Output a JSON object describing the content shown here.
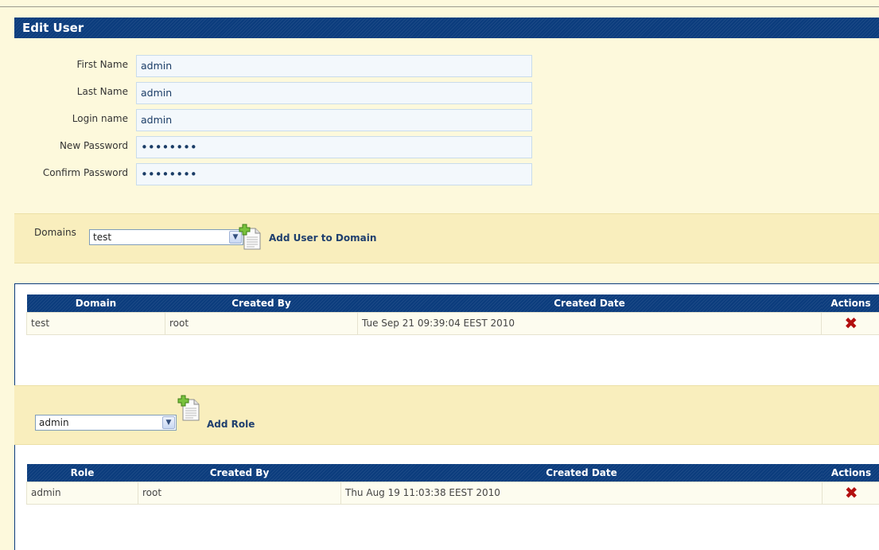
{
  "header": {
    "title": "Edit User"
  },
  "form": {
    "fields": [
      {
        "label": "First Name",
        "value": "admin"
      },
      {
        "label": "Last Name",
        "value": "admin"
      },
      {
        "label": "Login name",
        "value": "admin"
      },
      {
        "label": "New Password",
        "value": "••••••••"
      },
      {
        "label": "Confirm Password",
        "value": "••••••••"
      }
    ]
  },
  "domains_bar": {
    "label": "Domains",
    "selected": "test",
    "add_label": "Add User to Domain",
    "add_icon": "add-document-icon"
  },
  "domains_table": {
    "columns": [
      "Domain",
      "Created By",
      "Created Date",
      "Actions"
    ],
    "rows": [
      {
        "domain": "test",
        "created_by": "root",
        "created_date": "Tue Sep 21 09:39:04 EEST 2010",
        "action_icon": "✖"
      }
    ]
  },
  "roles_bar": {
    "selected": "admin",
    "add_label": "Add Role",
    "add_icon": "add-document-icon"
  },
  "roles_table": {
    "columns": [
      "Role",
      "Created By",
      "Created Date",
      "Actions"
    ],
    "rows": [
      {
        "role": "admin",
        "created_by": "root",
        "created_date": "Thu Aug 19 11:03:38 EEST 2010",
        "action_icon": "✖"
      }
    ]
  },
  "colors": {
    "header_blue": "#0b3c7d",
    "page_bg": "#fdf9dc",
    "band_bg": "#f9eebd",
    "delete_red": "#b30f0f"
  }
}
